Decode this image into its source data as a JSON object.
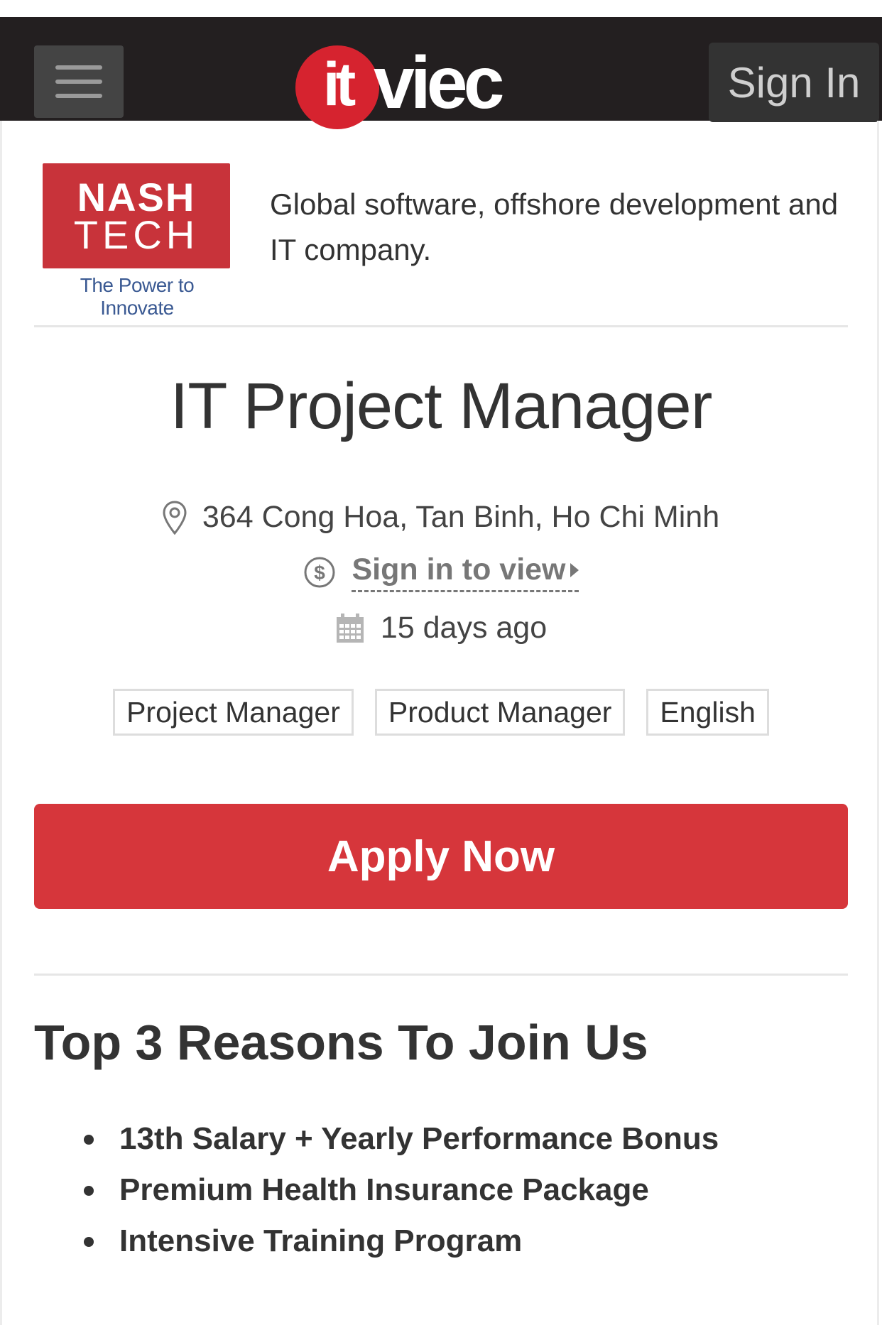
{
  "header": {
    "logo_it": "it",
    "logo_viec": "viec",
    "sign_in_label": "Sign In"
  },
  "company": {
    "logo_line1": "NASH",
    "logo_line2": "TECH",
    "logo_tagline": "The Power to Innovate",
    "description": "Global software, offshore development and IT company."
  },
  "job": {
    "title": "IT Project Manager",
    "address": "364 Cong Hoa, Tan Binh, Ho Chi Minh",
    "salary_link": "Sign in to view",
    "posted": "15 days ago",
    "tags": [
      "Project Manager",
      "Product Manager",
      "English"
    ],
    "apply_label": "Apply Now"
  },
  "reasons": {
    "title": "Top 3 Reasons To Join Us",
    "items": [
      "13th Salary + Yearly Performance Bonus",
      "Premium Health Insurance Package",
      "Intensive Training Program"
    ]
  },
  "colors": {
    "navbar": "#231f20",
    "brand_red": "#d6232f",
    "apply_red": "#d6363b",
    "nash_red": "#c8333a",
    "text": "#333333"
  }
}
